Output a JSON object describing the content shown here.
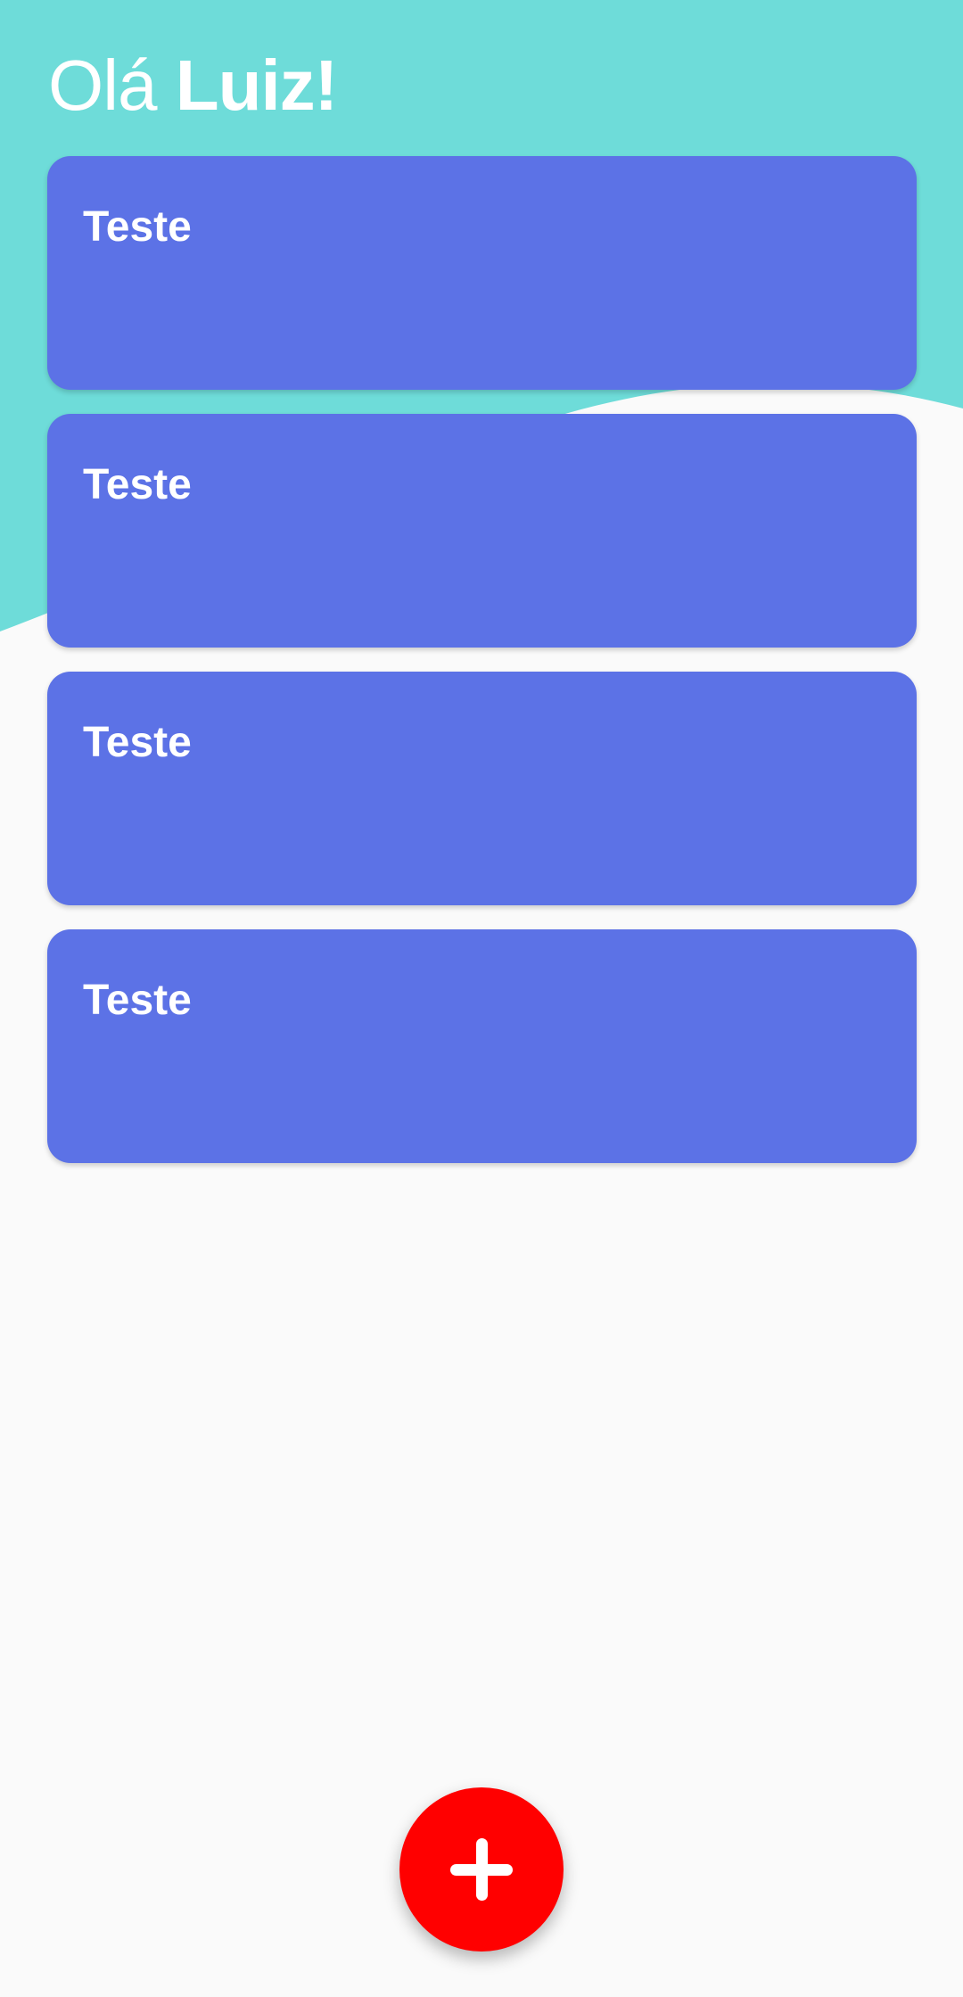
{
  "header": {
    "greeting_prefix": "Olá ",
    "user_name": "Luiz!"
  },
  "cards": [
    {
      "title": "Teste"
    },
    {
      "title": "Teste"
    },
    {
      "title": "Teste"
    },
    {
      "title": "Teste"
    }
  ],
  "fab": {
    "icon": "plus-icon"
  },
  "colors": {
    "header_background": "#6edcd9",
    "page_background": "#fafafa",
    "card_background": "#5c72e6",
    "fab_background": "#ff0000",
    "text_on_color": "#ffffff"
  }
}
